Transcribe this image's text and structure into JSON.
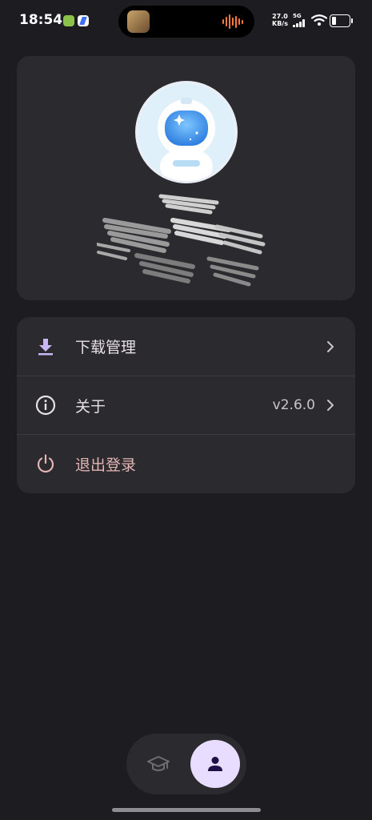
{
  "status_bar": {
    "time": "18:54",
    "net_speed_value": "27.0",
    "net_speed_unit": "KB/s",
    "signal_label": "5G",
    "battery_percent": 25
  },
  "profile": {
    "avatar_icon": "astronaut-avatar-icon"
  },
  "menu": {
    "items": [
      {
        "label": "下载管理",
        "icon": "download-icon",
        "value": ""
      },
      {
        "label": "关于",
        "icon": "info-icon",
        "value": "v2.6.0"
      },
      {
        "label": "退出登录",
        "icon": "power-icon",
        "value": ""
      }
    ]
  },
  "bottom_nav": {
    "items": [
      {
        "icon": "graduation-cap-icon",
        "selected": false
      },
      {
        "icon": "person-icon",
        "selected": true
      }
    ]
  },
  "colors": {
    "background": "#1d1c20",
    "card": "#2b2a2e",
    "accent": "#c9b6f5",
    "logout": "#e3b5b5",
    "nav_selected": "#e9ddff"
  }
}
